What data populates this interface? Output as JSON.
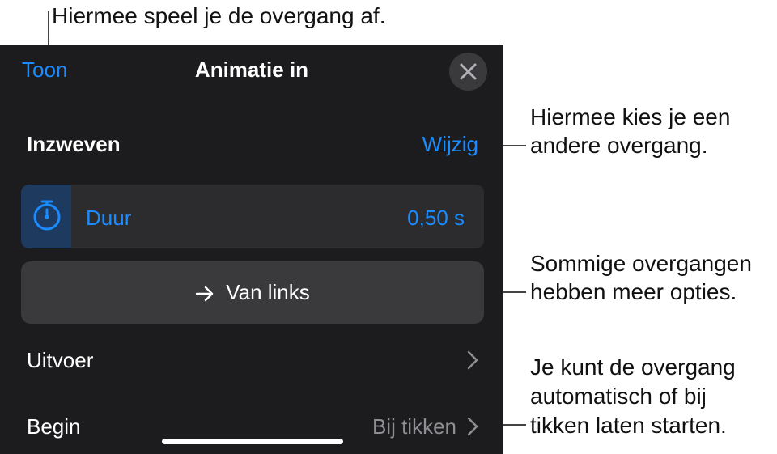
{
  "callouts": {
    "play": "Hiermee speel je de overgang af.",
    "change": [
      "Hiermee kies je een",
      "andere overgang."
    ],
    "options": [
      "Sommige overgangen",
      "hebben meer opties."
    ],
    "start": [
      "Je kunt de overgang",
      "automatisch of bij",
      "tikken laten starten."
    ]
  },
  "nav": {
    "show_label": "Toon",
    "title": "Animatie in",
    "close_icon": "close-icon"
  },
  "effect": {
    "name": "Inzweven",
    "change_label": "Wijzig"
  },
  "duration": {
    "icon": "stopwatch-icon",
    "label": "Duur",
    "value": "0,50 s"
  },
  "direction": {
    "icon": "arrow-right-icon",
    "label": "Van links"
  },
  "list": {
    "output_label": "Uitvoer",
    "start_label": "Begin",
    "start_value": "Bij tikken"
  },
  "colors": {
    "panel_bg": "#1c1c1e",
    "accent": "#1a8cff",
    "row_bg": "#2c2c2e",
    "button_bg": "#3a3a3c",
    "secondary_text": "#8e8e93"
  }
}
